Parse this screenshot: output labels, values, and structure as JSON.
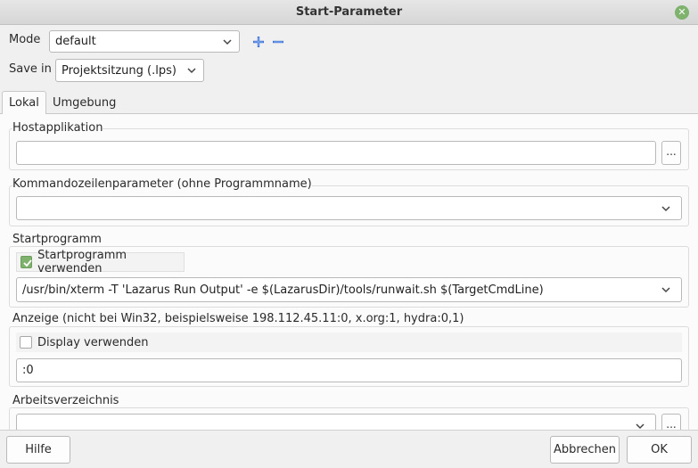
{
  "window": {
    "title": "Start-Parameter",
    "close_icon": "close-icon"
  },
  "mode": {
    "label": "Mode",
    "value": "default"
  },
  "save_in": {
    "label": "Save in",
    "value": "Projektsitzung (.lps)"
  },
  "tabs": [
    {
      "label": "Lokal",
      "active": true
    },
    {
      "label": "Umgebung",
      "active": false
    }
  ],
  "host": {
    "title": "Hostapplikation",
    "value": "",
    "browse_label": "..."
  },
  "cmdline": {
    "title": "Kommandozeilenparameter (ohne Programmname)",
    "value": ""
  },
  "launcher": {
    "title": "Startprogramm",
    "checkbox_label": "Startprogramm verwenden",
    "checked": true,
    "value": "/usr/bin/xterm -T 'Lazarus Run Output' -e $(LazarusDir)/tools/runwait.sh $(TargetCmdLine)"
  },
  "display": {
    "title": "Anzeige (nicht bei Win32, beispielsweise 198.112.45.11:0, x.org:1, hydra:0,1)",
    "checkbox_label": "Display verwenden",
    "checked": false,
    "value": ":0"
  },
  "workdir": {
    "title": "Arbeitsverzeichnis",
    "value": "",
    "browse_label": "..."
  },
  "buttons": {
    "help": "Hilfe",
    "cancel": "Abbrechen",
    "ok": "OK"
  },
  "colors": {
    "accent": "#7eb26d",
    "add_icon": "#3a6fd8",
    "panel": "#fbfbfb",
    "window": "#f0f0f0"
  }
}
